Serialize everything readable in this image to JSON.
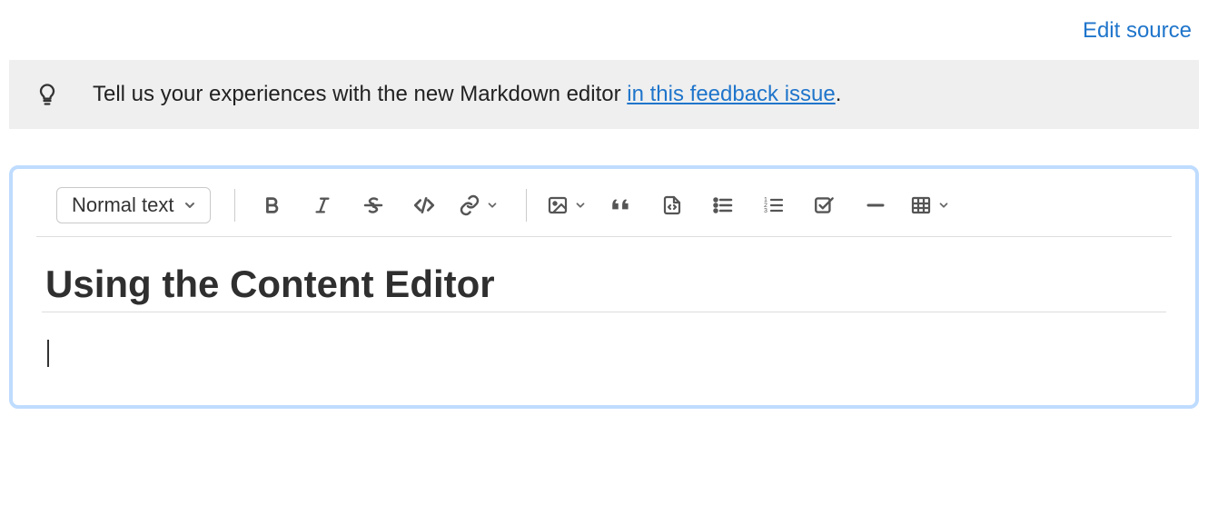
{
  "header": {
    "edit_source": "Edit source"
  },
  "notice": {
    "text_before": "Tell us your experiences with the new Markdown editor ",
    "link_text": "in this feedback issue",
    "text_after": "."
  },
  "toolbar": {
    "text_style": "Normal text"
  },
  "document": {
    "title": "Using the Content Editor"
  }
}
